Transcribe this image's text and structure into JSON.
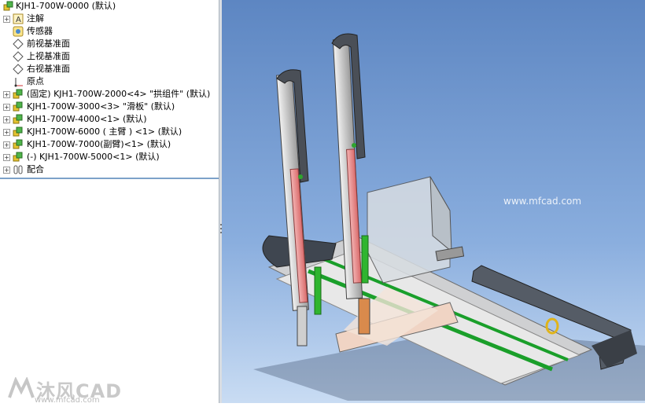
{
  "feature_tree": {
    "root": {
      "label": "KJH1-700W-0000  (默认)",
      "icon": "assembly-icon"
    },
    "items": [
      {
        "label": "注解",
        "icon": "annotation-icon",
        "expander": "+"
      },
      {
        "label": "传感器",
        "icon": "sensor-icon",
        "expander": ""
      },
      {
        "label": "前视基准面",
        "icon": "plane-icon",
        "expander": ""
      },
      {
        "label": "上视基准面",
        "icon": "plane-icon",
        "expander": ""
      },
      {
        "label": "右视基准面",
        "icon": "plane-icon",
        "expander": ""
      },
      {
        "label": "原点",
        "icon": "origin-icon",
        "expander": ""
      },
      {
        "label": "(固定) KJH1-700W-2000<4> \"拱组件\" (默认)",
        "icon": "subassembly-icon",
        "expander": "+"
      },
      {
        "label": "KJH1-700W-3000<3> \"滑板\" (默认)",
        "icon": "subassembly-icon",
        "expander": "+"
      },
      {
        "label": "KJH1-700W-4000<1> (默认)",
        "icon": "subassembly-icon",
        "expander": "+"
      },
      {
        "label": "KJH1-700W-6000 ( 主臂 ) <1> (默认)",
        "icon": "subassembly-icon",
        "expander": "+"
      },
      {
        "label": "KJH1-700W-7000(副臂)<1> (默认)",
        "icon": "subassembly-icon",
        "expander": "+"
      },
      {
        "label": "(-) KJH1-700W-5000<1> (默认)",
        "icon": "subassembly-icon",
        "expander": "+"
      },
      {
        "label": "配合",
        "icon": "mates-icon",
        "expander": "+"
      }
    ]
  },
  "watermark": {
    "brand": "沐风CAD",
    "url": "www.mfcad.com",
    "viewport_url": "www.mfcad.com"
  },
  "colors": {
    "viewport_top": "#5d86c2",
    "viewport_bottom": "#c9dcf3",
    "tree_separator": "#7da2c9"
  }
}
